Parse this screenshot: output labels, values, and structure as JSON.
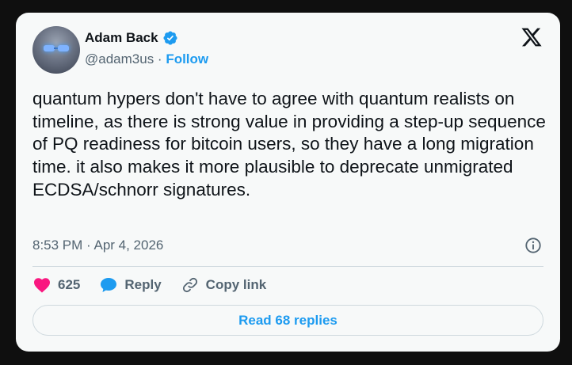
{
  "author": {
    "name": "Adam Back",
    "handle": "@adam3us",
    "separator": " · ",
    "follow_label": "Follow"
  },
  "tweet": {
    "text": "quantum hypers don't have to agree with quantum realists on timeline, as there is strong value in providing a step-up sequence of PQ readiness for bitcoin users, so they have a long migration time. it also makes it more plausible to deprecate unmigrated ECDSA/schnorr signatures.",
    "timestamp": "8:53 PM · Apr 4, 2026"
  },
  "actions": {
    "like_count": "625",
    "reply_label": "Reply",
    "copy_link_label": "Copy link"
  },
  "read_replies_label": "Read 68 replies",
  "icons": {
    "like": "heart-icon",
    "reply": "chat-bubble-icon",
    "copy": "link-icon",
    "info": "info-icon",
    "brand": "x-logo-icon",
    "verified": "verified-badge-icon"
  },
  "colors": {
    "accent": "#1d9bf0",
    "like": "#f91880",
    "text": "#0f1419",
    "muted": "#536471",
    "card": "#f7f9f9",
    "background": "#0f0f0f"
  }
}
